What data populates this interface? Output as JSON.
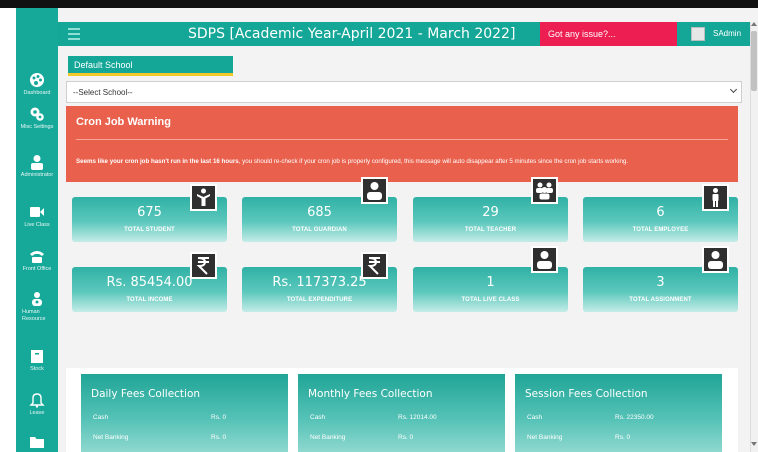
{
  "header": {
    "title": "SDPS [Academic Year-April 2021 - March 2022]",
    "issue_label": "Got any issue?...",
    "user": "SAdmin"
  },
  "sidebar": {
    "items": [
      {
        "label": "Dashboard",
        "icon": "palette-icon"
      },
      {
        "label": "Misc Settings",
        "icon": "gears-icon"
      },
      {
        "label": "Administrator",
        "icon": "user-icon"
      },
      {
        "label": "Live Class",
        "icon": "video-icon"
      },
      {
        "label": "Front Office",
        "icon": "phone-icon"
      },
      {
        "label": "Human Resource",
        "icon": "users-icon"
      },
      {
        "label": "Stock",
        "icon": "archive-icon"
      },
      {
        "label": "Leave",
        "icon": "bell-icon"
      },
      {
        "label": "",
        "icon": "folder-icon"
      }
    ]
  },
  "school": {
    "tag": "Default School",
    "select_value": "--Select School--"
  },
  "warning": {
    "title": "Cron Job Warning",
    "message_bold": "Seems like your cron job hasn't run in the last 16 hours",
    "message_rest": ", you should re-check if your cron job is properly configured, this message will auto disappear after 5 minutes since the cron job starts working."
  },
  "stats": [
    {
      "value": "675",
      "label": "TOTAL STUDENT",
      "icon": "child-icon"
    },
    {
      "value": "685",
      "label": "TOTAL GUARDIAN",
      "icon": "user-icon"
    },
    {
      "value": "29",
      "label": "TOTAL TEACHER",
      "icon": "group-icon"
    },
    {
      "value": "6",
      "label": "TOTAL EMPLOYEE",
      "icon": "person-icon"
    },
    {
      "value": "Rs. 85454.00",
      "label": "TOTAL INCOME",
      "icon": "rupee-icon"
    },
    {
      "value": "Rs. 117373.25",
      "label": "TOTAL EXPENDITURE",
      "icon": "rupee-icon"
    },
    {
      "value": "1",
      "label": "TOTAL LIVE CLASS",
      "icon": "user-icon"
    },
    {
      "value": "3",
      "label": "TOTAL ASSIGNMENT",
      "icon": "user-icon"
    }
  ],
  "collections": [
    {
      "title": "Daily Fees Collection",
      "rows": [
        {
          "label": "Cash",
          "value": "Rs. 0"
        },
        {
          "label": "Net Banking",
          "value": "Rs. 0"
        }
      ]
    },
    {
      "title": "Monthly Fees Collection",
      "rows": [
        {
          "label": "Cash",
          "value": "Rs. 12014.00"
        },
        {
          "label": "Net Banking",
          "value": "Rs. 0"
        }
      ]
    },
    {
      "title": "Session Fees Collection",
      "rows": [
        {
          "label": "Cash",
          "value": "Rs. 22350.00"
        },
        {
          "label": "Net Banking",
          "value": "Rs. 0"
        }
      ]
    }
  ],
  "colors": {
    "teal": "#16a99a",
    "warning": "#e9604c",
    "issue": "#ed1f52"
  }
}
